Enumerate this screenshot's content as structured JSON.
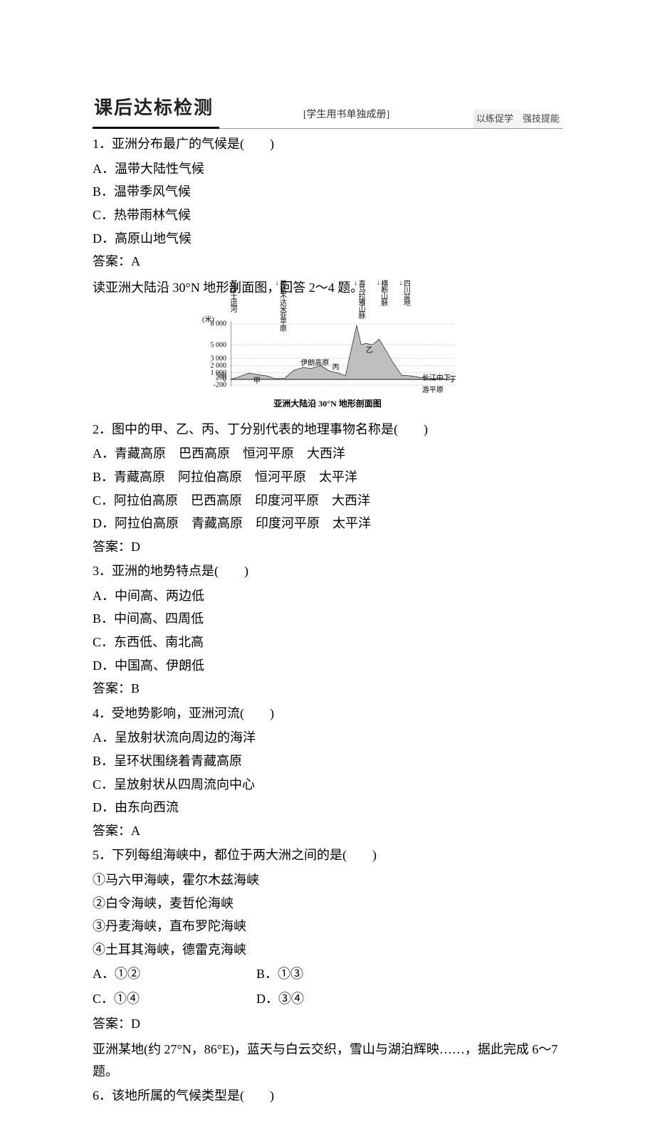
{
  "header": {
    "title": "课后达标检测",
    "booklet_note": "[学生用书单独成册]",
    "tag": "以练促学　强技提能"
  },
  "q1": {
    "stem": "1．亚洲分布最广的气候是(　　)",
    "A": "A．温带大陆性气候",
    "B": "B．温带季风气候",
    "C": "C．热带雨林气候",
    "D": "D．高原山地气候",
    "ans": "答案：A"
  },
  "fig_intro": "读亚洲大陆沿 30°N 地形剖面图，回答 2～4 题。",
  "chart_data": {
    "type": "area",
    "title": "亚洲大陆沿 30°N 地形剖面图",
    "ylabel": "(米)",
    "yticks": [
      -200,
      0,
      200,
      500,
      1000,
      2000,
      3000,
      5000,
      8000
    ],
    "top_labels": [
      {
        "name": "苏伊士运河",
        "x": 0
      },
      {
        "name": "美索不达米亚平原",
        "x": 22
      },
      {
        "name": "喜马拉雅山脉",
        "x": 57
      },
      {
        "name": "横断山脉",
        "x": 67
      },
      {
        "name": "四川盆地",
        "x": 77
      }
    ],
    "inline_labels": [
      {
        "name": "甲",
        "x": 12,
        "y_frac": 0.82
      },
      {
        "name": "伊朗高原",
        "x": 33,
        "y_frac": 0.55
      },
      {
        "name": "丙",
        "x": 47,
        "y_frac": 0.62
      },
      {
        "name": "乙",
        "x": 62,
        "y_frac": 0.35
      },
      {
        "name": "长江中下游平原",
        "x": 87,
        "y_frac": 0.78
      },
      {
        "name": "丁",
        "x": 99,
        "y_frac": 0.8
      }
    ],
    "profile": [
      {
        "x": 0,
        "y": 0
      },
      {
        "x": 3,
        "y": 300
      },
      {
        "x": 8,
        "y": 900
      },
      {
        "x": 12,
        "y": 700
      },
      {
        "x": 16,
        "y": 500
      },
      {
        "x": 20,
        "y": 100
      },
      {
        "x": 24,
        "y": 150
      },
      {
        "x": 28,
        "y": 1300
      },
      {
        "x": 32,
        "y": 1700
      },
      {
        "x": 36,
        "y": 1600
      },
      {
        "x": 40,
        "y": 2000
      },
      {
        "x": 44,
        "y": 1200
      },
      {
        "x": 48,
        "y": 900
      },
      {
        "x": 51,
        "y": 500
      },
      {
        "x": 53,
        "y": 3500
      },
      {
        "x": 56,
        "y": 7800
      },
      {
        "x": 58,
        "y": 5000
      },
      {
        "x": 60,
        "y": 5200
      },
      {
        "x": 63,
        "y": 5000
      },
      {
        "x": 66,
        "y": 5800
      },
      {
        "x": 69,
        "y": 4200
      },
      {
        "x": 72,
        "y": 2500
      },
      {
        "x": 76,
        "y": 600
      },
      {
        "x": 80,
        "y": 500
      },
      {
        "x": 84,
        "y": 300
      },
      {
        "x": 88,
        "y": 150
      },
      {
        "x": 92,
        "y": 100
      },
      {
        "x": 96,
        "y": 50
      },
      {
        "x": 100,
        "y": 0
      }
    ]
  },
  "q2": {
    "stem": "2．图中的甲、乙、丙、丁分别代表的地理事物名称是(　　)",
    "A": "A．青藏高原　巴西高原　恒河平原　大西洋",
    "B": "B．青藏高原　阿拉伯高原　恒河平原　太平洋",
    "C": "C．阿拉伯高原　巴西高原　印度河平原　大西洋",
    "D": "D．阿拉伯高原　青藏高原　印度河平原　太平洋",
    "ans": "答案：D"
  },
  "q3": {
    "stem": "3．亚洲的地势特点是(　　)",
    "A": "A．中间高、两边低",
    "B": "B．中间高、四周低",
    "C": "C．东西低、南北高",
    "D": "D．中国高、伊朗低",
    "ans": "答案：B"
  },
  "q4": {
    "stem": "4．受地势影响，亚洲河流(　　)",
    "A": "A．呈放射状流向周边的海洋",
    "B": "B．呈环状围绕着青藏高原",
    "C": "C．呈放射状从四周流向中心",
    "D": "D．由东向西流",
    "ans": "答案：A"
  },
  "q5": {
    "stem": "5．下列每组海峡中，都位于两大洲之间的是(　　)",
    "i1": "①马六甲海峡，霍尔木兹海峡",
    "i2": "②白令海峡，麦哲伦海峡",
    "i3": "③丹麦海峡，直布罗陀海峡",
    "i4": "④土耳其海峡，德雷克海峡",
    "A": "A．①②",
    "B": "B．①③",
    "C": "C．①④",
    "D": "D．③④",
    "ans": "答案：D"
  },
  "stem67": "亚洲某地(约 27°N，86°E)，蓝天与白云交织，雪山与湖泊辉映……，据此完成 6～7 题。",
  "q6": {
    "stem": "6．该地所属的气候类型是(　　)"
  }
}
